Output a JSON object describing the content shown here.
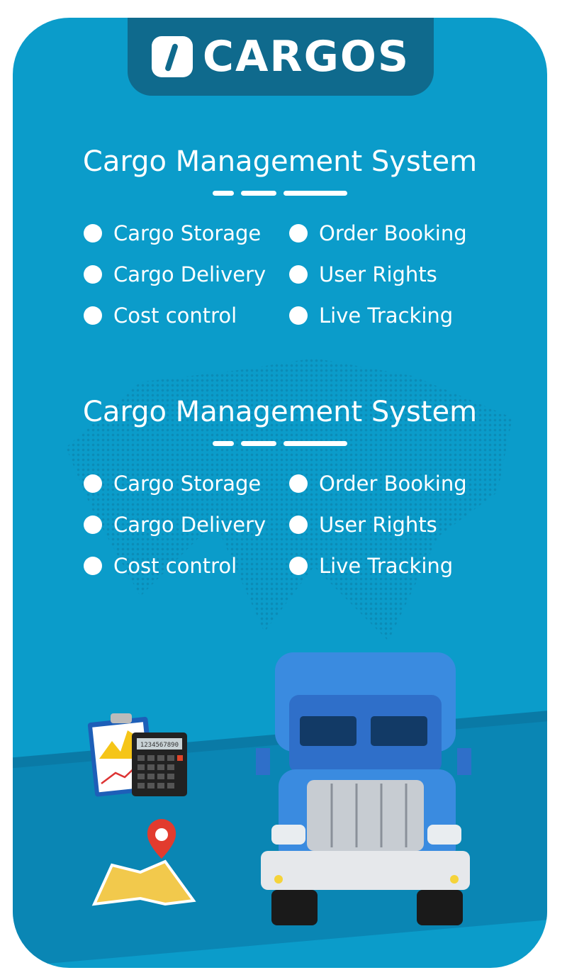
{
  "brand": {
    "name": "CARGOS"
  },
  "sections": [
    {
      "title": "Cargo Management System",
      "features": [
        "Cargo Storage",
        "Order Booking",
        "Cargo Delivery",
        "User Rights",
        "Cost control",
        "Live Tracking"
      ]
    },
    {
      "title": "Cargo Management System",
      "features": [
        "Cargo Storage",
        "Order Booking",
        "Cargo Delivery",
        "User Rights",
        "Cost control",
        "Live Tracking"
      ]
    }
  ],
  "calculator": {
    "display": "1234567890"
  },
  "colors": {
    "background": "#0b9cca",
    "logo_tab": "#0f6a8d",
    "truck": "#2f7fd6"
  },
  "icons": [
    "clipboard-chart-icon",
    "calculator-icon",
    "map-pin-icon",
    "truck-illustration"
  ]
}
